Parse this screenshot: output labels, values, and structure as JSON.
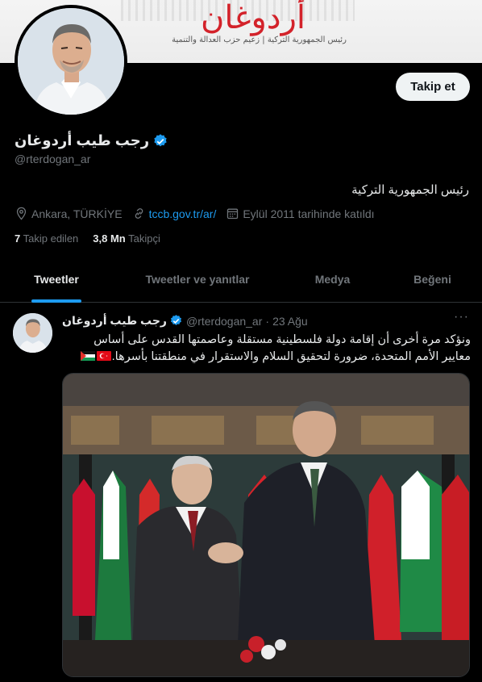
{
  "banner": {
    "title": "أردوغان",
    "subtitle": "رئيس الجمهورية التركية | زعيم حزب العدالة والتنمية"
  },
  "profile": {
    "display_name": "رجب طيب أردوغان",
    "handle": "@rterdogan_ar",
    "bio": "رئيس الجمهورية التركية",
    "location": "Ankara, TÜRKİYE",
    "link": "tccb.gov.tr/ar/",
    "joined": "Eylül 2011 tarihinde katıldı",
    "following_count": "7",
    "following_label": "Takip edilen",
    "followers_count": "3,8 Mn",
    "followers_label": "Takipçi",
    "follow_button": "Takip et"
  },
  "tabs": [
    {
      "label": "Tweetler",
      "active": true
    },
    {
      "label": "Tweetler ve yanıtlar",
      "active": false
    },
    {
      "label": "Medya",
      "active": false
    },
    {
      "label": "Beğeni",
      "active": false
    }
  ],
  "tweet": {
    "name": "رجب طيب أردوغان",
    "handle": "@rterdogan_ar",
    "separator": "·",
    "date": "23 Ağu",
    "more": "···",
    "text": "ونؤكد مرة أخرى أن إقامة دولة فلسطينية مستقلة وعاصمتها القدس على أساس معايير الأمم المتحدة، ضرورة لتحقيق السلام والاستقرار في منطقتنا بأسرها."
  },
  "colors": {
    "accent": "#1d9bf0",
    "background": "#000000",
    "muted": "#71767b",
    "banner_red": "#d3222a"
  },
  "icons": [
    "location-icon",
    "link-icon",
    "calendar-icon",
    "verified-badge-icon",
    "more-icon",
    "turkey-flag-icon",
    "palestine-flag-icon"
  ]
}
